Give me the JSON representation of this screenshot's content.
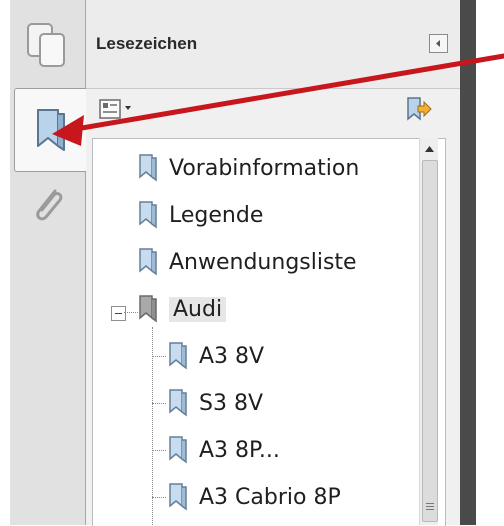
{
  "panel": {
    "title": "Lesezeichen"
  },
  "tree": {
    "items": [
      {
        "label": "Vorabinformation"
      },
      {
        "label": "Legende"
      },
      {
        "label": "Anwendungsliste"
      },
      {
        "label": "Audi",
        "expanded": true,
        "selected": true
      },
      {
        "label": "A3 8V",
        "child": true
      },
      {
        "label": "S3 8V",
        "child": true
      },
      {
        "label": "A3 8P...",
        "child": true
      },
      {
        "label": "A3 Cabrio 8P",
        "child": true
      }
    ]
  },
  "colors": {
    "annotation_arrow": "#c8161d",
    "bookmark_icon_fill": "#b9d3ea",
    "selected_row_bg": "#e6e6e6"
  },
  "icons": {
    "rail": [
      "pages-icon",
      "bookmark-icon",
      "attachment-icon"
    ],
    "toolbar": [
      "options-menu-icon",
      "new-bookmark-icon"
    ],
    "header": [
      "collapse-panel-icon"
    ]
  }
}
